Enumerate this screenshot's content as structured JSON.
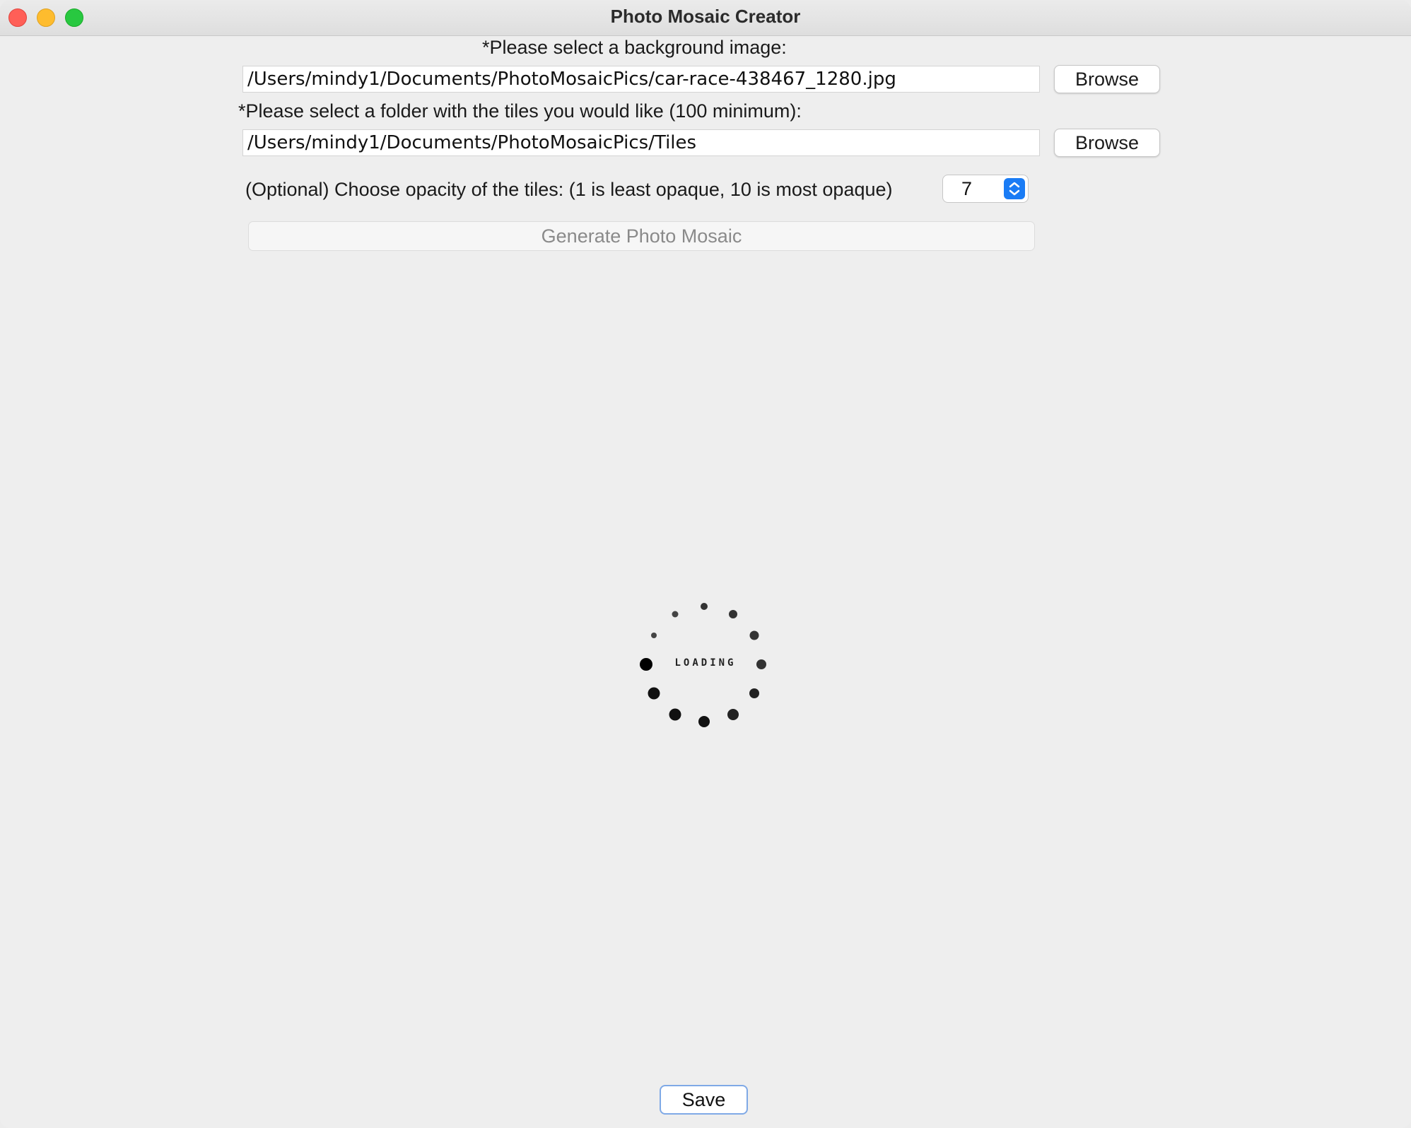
{
  "window": {
    "title": "Photo Mosaic Creator"
  },
  "background": {
    "label": "*Please select a background image:",
    "path": "/Users/mindy1/Documents/PhotoMosaicPics/car-race-438467_1280.jpg",
    "browse_label": "Browse"
  },
  "tiles": {
    "label": "*Please select a folder with the tiles you would like (100 minimum):",
    "path": "/Users/mindy1/Documents/PhotoMosaicPics/Tiles",
    "browse_label": "Browse"
  },
  "opacity": {
    "label": "(Optional) Choose opacity of the tiles: (1 is least opaque, 10 is most opaque)",
    "value": "7"
  },
  "generate": {
    "label": "Generate Photo Mosaic",
    "enabled": false
  },
  "loading": {
    "text": "LOADING"
  },
  "footer": {
    "save_label": "Save"
  },
  "colors": {
    "accent": "#1a7cf5",
    "traffic_close": "#ff5f57",
    "traffic_minimize": "#febc2e",
    "traffic_maximize": "#28c840"
  },
  "icons": {
    "spinner_arrows": "chevron-up-down-icon",
    "loading": "loading-dots-icon"
  }
}
